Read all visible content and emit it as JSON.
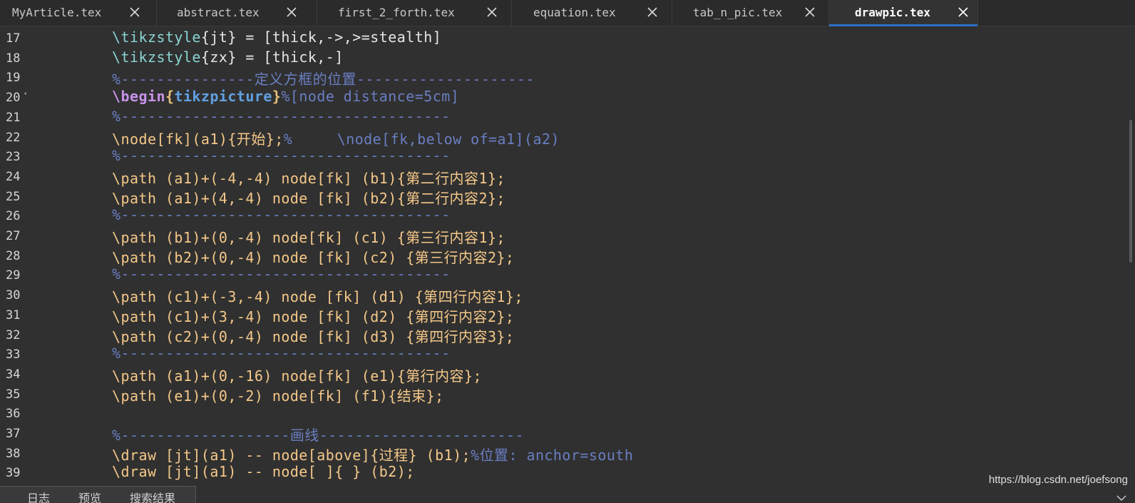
{
  "tabs": [
    {
      "label": "MyArticle.tex",
      "active": false
    },
    {
      "label": "abstract.tex",
      "active": false
    },
    {
      "label": "first_2_forth.tex",
      "active": false
    },
    {
      "label": "equation.tex",
      "active": false
    },
    {
      "label": "tab_n_pic.tex",
      "active": false
    },
    {
      "label": "drawpic.tex",
      "active": true
    }
  ],
  "lines": [
    {
      "num": "17",
      "text": "\\tikzstyle{jt} = [thick,->,>=stealth]"
    },
    {
      "num": "18",
      "text": "\\tikzstyle{zx} = [thick,-]"
    },
    {
      "num": "19",
      "text": "%---------------定义方框的位置--------------------"
    },
    {
      "num": "20",
      "text": "\\begin{tikzpicture}%[node distance=5cm]"
    },
    {
      "num": "21",
      "text": "%-------------------------------------"
    },
    {
      "num": "22",
      "text": "\\node[fk](a1){开始};%     \\node[fk,below of=a1](a2)"
    },
    {
      "num": "23",
      "text": "%-------------------------------------"
    },
    {
      "num": "24",
      "text": "\\path (a1)+(-4,-4) node[fk] (b1){第二行内容1};"
    },
    {
      "num": "25",
      "text": "\\path (a1)+(4,-4) node [fk] (b2){第二行内容2};"
    },
    {
      "num": "26",
      "text": "%-------------------------------------"
    },
    {
      "num": "27",
      "text": "\\path (b1)+(0,-4) node[fk] (c1) {第三行内容1};"
    },
    {
      "num": "28",
      "text": "\\path (b2)+(0,-4) node [fk] (c2) {第三行内容2};"
    },
    {
      "num": "29",
      "text": "%-------------------------------------"
    },
    {
      "num": "30",
      "text": "\\path (c1)+(-3,-4) node [fk] (d1) {第四行内容1};"
    },
    {
      "num": "31",
      "text": "\\path (c1)+(3,-4) node [fk] (d2) {第四行内容2};"
    },
    {
      "num": "32",
      "text": "\\path (c2)+(0,-4) node [fk] (d3) {第四行内容3};"
    },
    {
      "num": "33",
      "text": "%-------------------------------------"
    },
    {
      "num": "34",
      "text": "\\path (a1)+(0,-16) node[fk] (e1){第行内容};"
    },
    {
      "num": "35",
      "text": "\\path (e1)+(0,-2) node[fk] (f1){结束};"
    },
    {
      "num": "36",
      "text": ""
    },
    {
      "num": "37",
      "text": "%-------------------画线-----------------------"
    },
    {
      "num": "38",
      "text": "\\draw [jt](a1) -- node[above]{过程} (b1);%位置: anchor=south"
    },
    {
      "num": "39",
      "text": "\\draw [jt](a1) -- node[ ]{ } (b2);"
    }
  ],
  "bottom_tabs": [
    "日志",
    "预览",
    "搜索结果"
  ],
  "watermark": "https://blog.csdn.net/joefsong",
  "colors": {
    "background": "#303030",
    "accent": "#2d6fc7",
    "command": "#f5c889",
    "comment": "#6a7ec2",
    "keyword": "#c792ea"
  }
}
